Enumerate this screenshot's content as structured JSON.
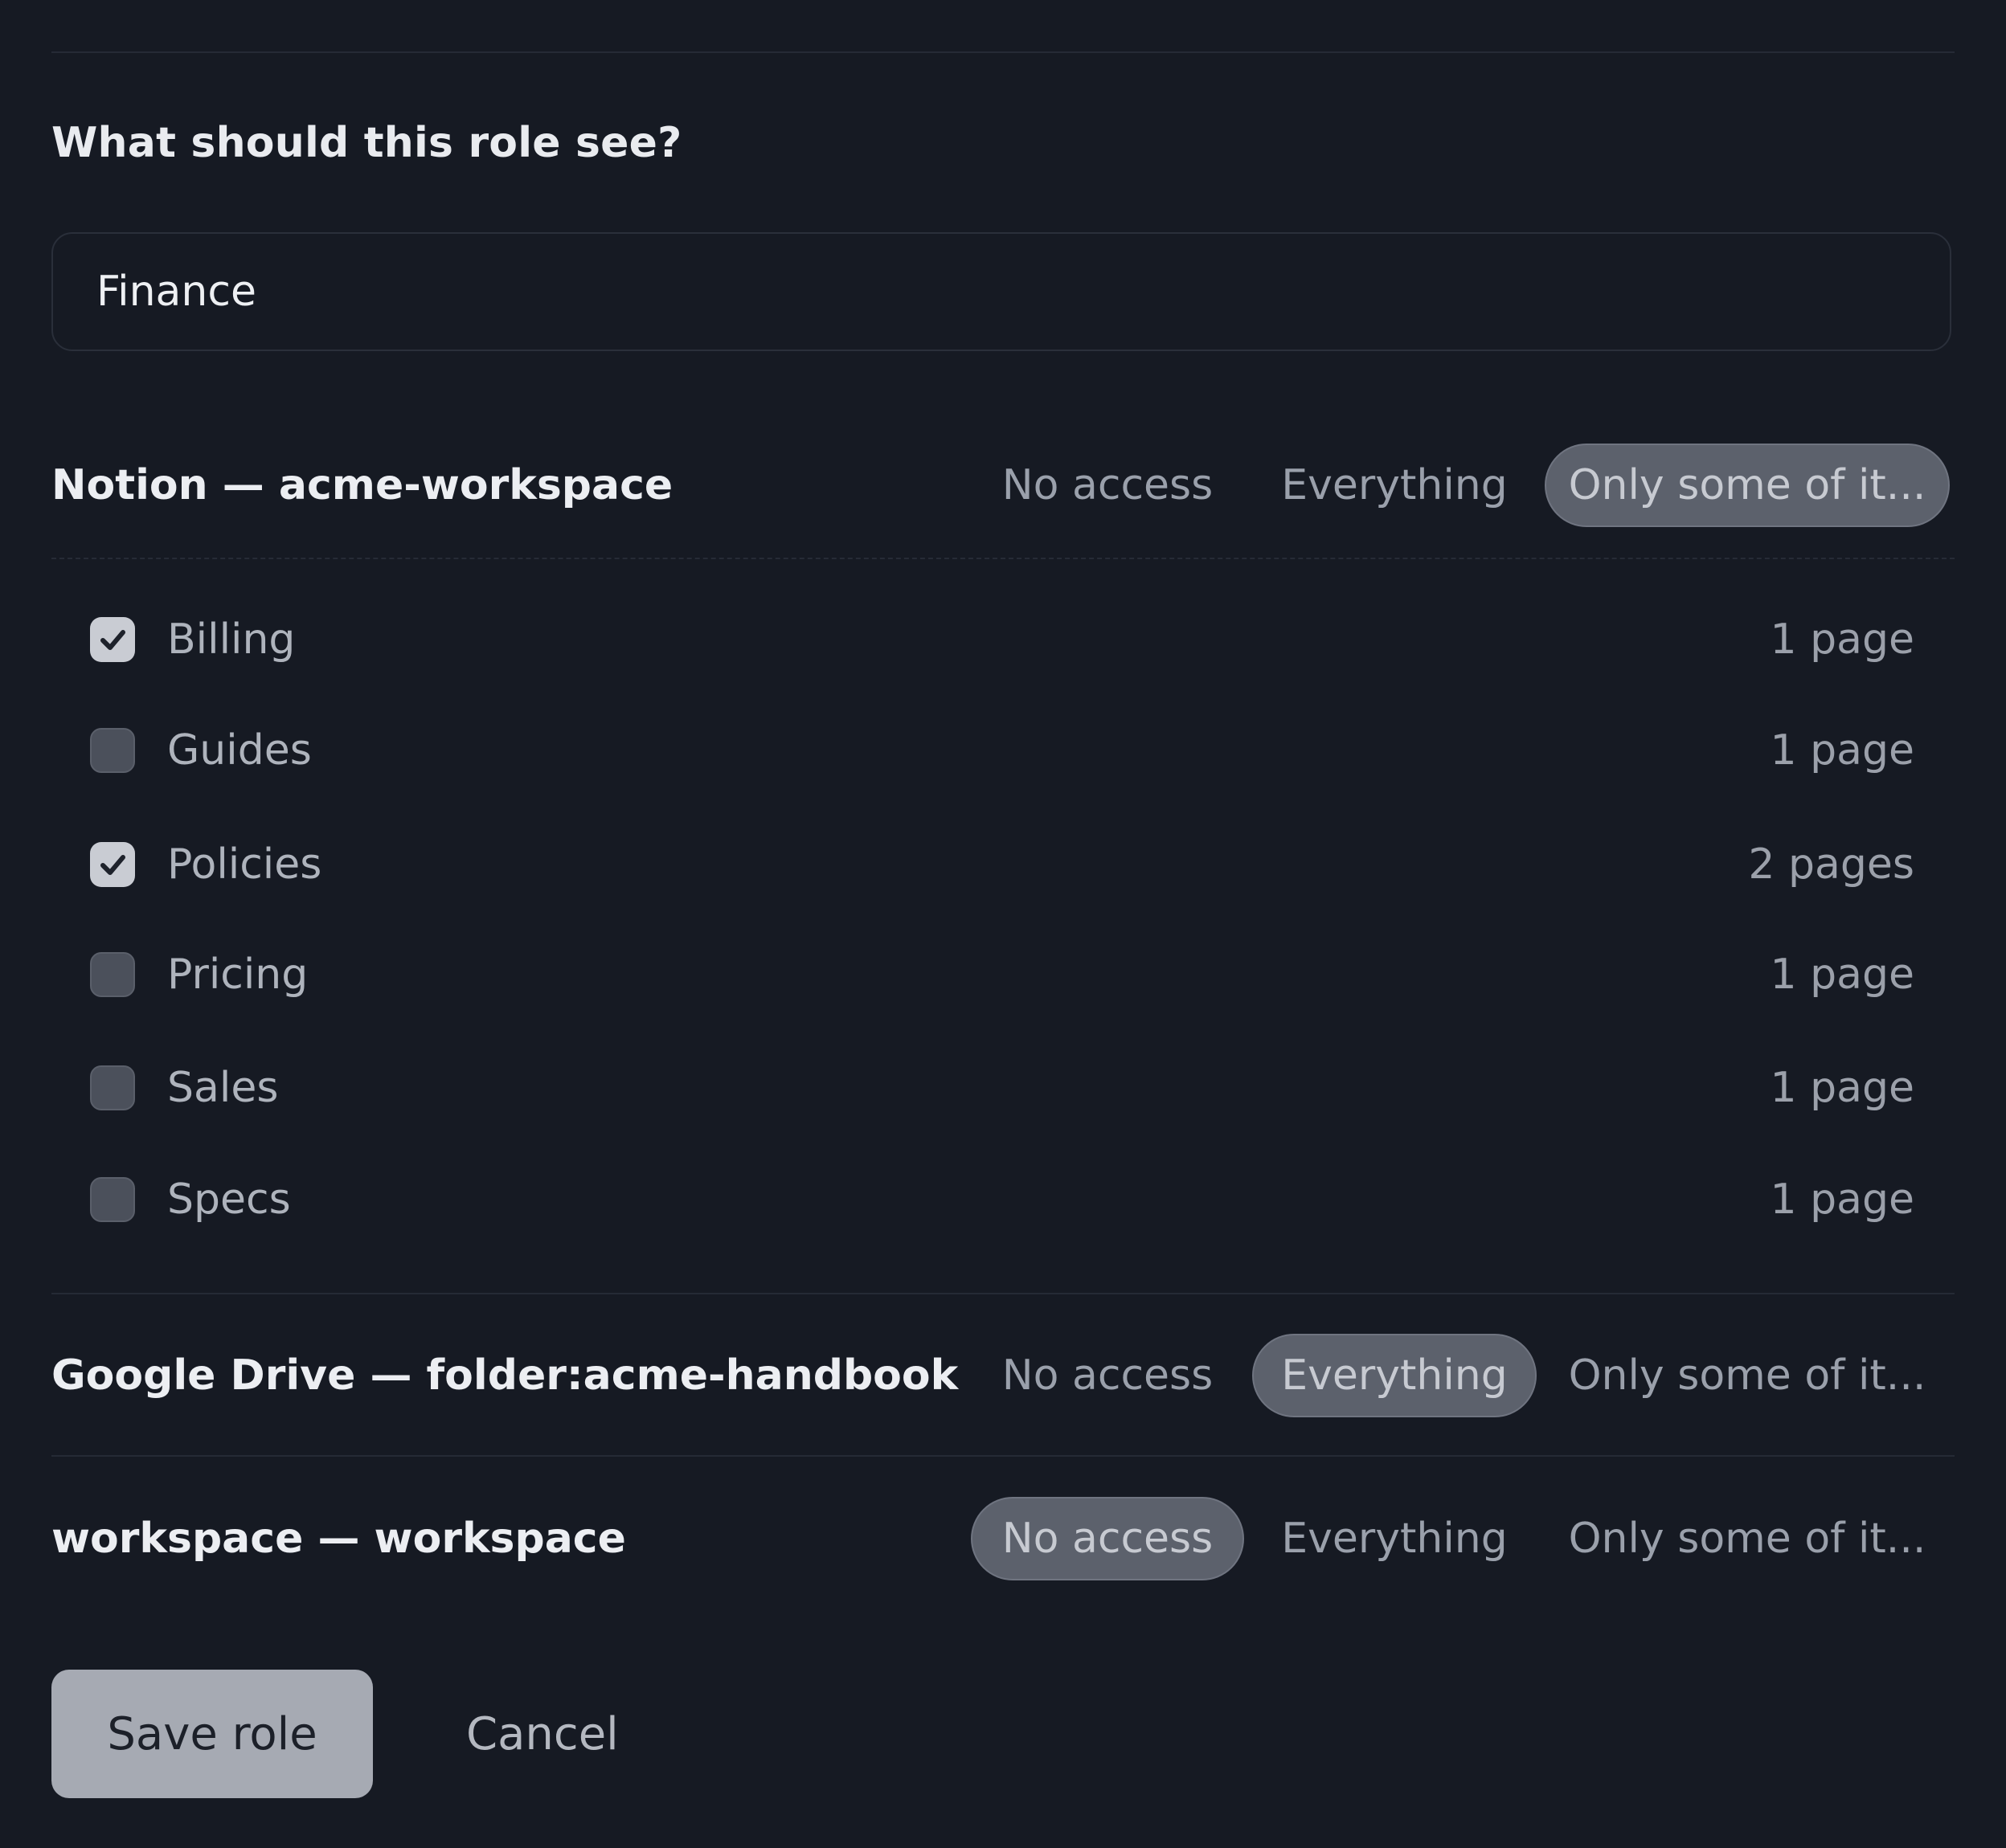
{
  "role_form": {
    "question": "What should this role see?",
    "role_name_value": "Finance",
    "role_name_placeholder": ""
  },
  "access_options": {
    "no_access": "No access",
    "everything": "Everything",
    "only_some": "Only some of it..."
  },
  "sources": [
    {
      "title": "Notion — acme-workspace",
      "selected": "only_some",
      "items": [
        {
          "label": "Billing",
          "count": "1 page",
          "checked": true
        },
        {
          "label": "Guides",
          "count": "1 page",
          "checked": false
        },
        {
          "label": "Policies",
          "count": "2 pages",
          "checked": true
        },
        {
          "label": "Pricing",
          "count": "1 page",
          "checked": false
        },
        {
          "label": "Sales",
          "count": "1 page",
          "checked": false
        },
        {
          "label": "Specs",
          "count": "1 page",
          "checked": false
        }
      ]
    },
    {
      "title": "Google Drive — folder:acme-handbook",
      "selected": "everything"
    },
    {
      "title": "workspace — workspace",
      "selected": "no_access"
    }
  ],
  "actions": {
    "save_label": "Save role",
    "cancel_label": "Cancel"
  },
  "icons": {
    "checkbox_checked": "check-icon"
  },
  "colors": {
    "background": "#161a23",
    "active_segment": "#5c616c",
    "checked_box": "#c9ccd3",
    "save_button": "#a6aab3"
  }
}
